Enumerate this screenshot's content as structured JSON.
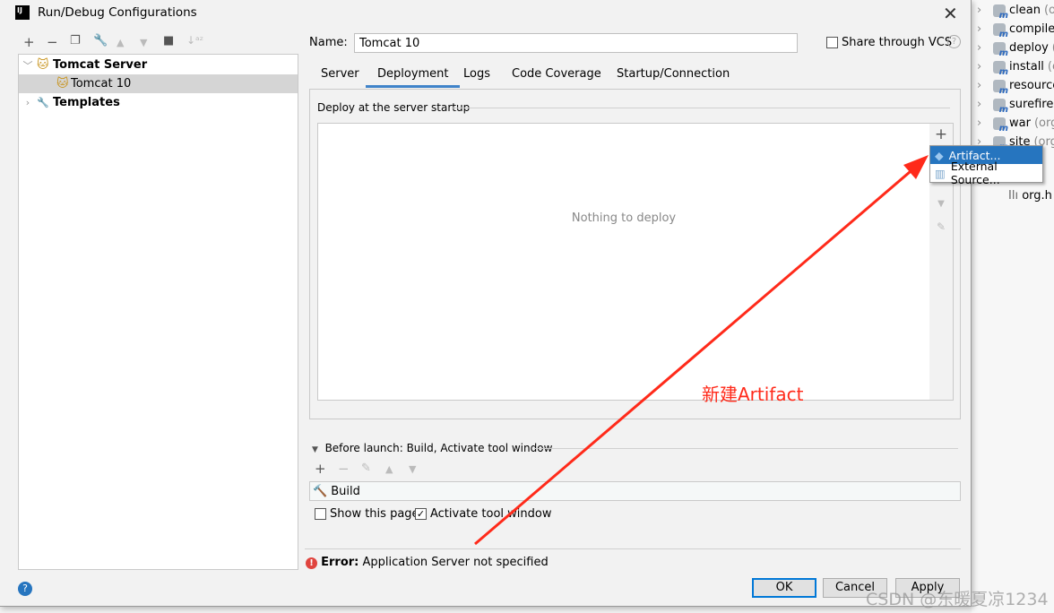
{
  "dialog": {
    "title": "Run/Debug Configurations",
    "logo": "IJ"
  },
  "toolbar": {
    "icons": [
      "plus-icon",
      "minus-icon",
      "copy-icon",
      "wrench-icon",
      "arrow-up-icon",
      "arrow-down-icon",
      "folder-add-icon",
      "sort-az-icon"
    ]
  },
  "tree": {
    "items": [
      {
        "label": "Tomcat Server",
        "expanded": true
      },
      {
        "label": "Tomcat 10",
        "selected": true
      },
      {
        "label": "Templates",
        "expanded": false
      }
    ]
  },
  "name": {
    "label": "Name:",
    "value": "Tomcat 10"
  },
  "share": {
    "label": "Share through VCS",
    "checked": false
  },
  "tabs": [
    "Server",
    "Deployment",
    "Logs",
    "Code Coverage",
    "Startup/Connection"
  ],
  "active_tab": "Deployment",
  "deploy": {
    "title": "Deploy at the server startup",
    "empty": "Nothing to deploy"
  },
  "popup": {
    "items": [
      "Artifact...",
      "External Source..."
    ]
  },
  "before_launch": {
    "title": "Before launch: Build, Activate tool window",
    "item": "Build"
  },
  "options": {
    "show_page": "Show this page",
    "show_page_checked": false,
    "activate": "Activate tool window",
    "activate_checked": true
  },
  "error": {
    "label": "Error:",
    "message": "Application Server not specified"
  },
  "buttons": {
    "ok": "OK",
    "cancel": "Cancel",
    "apply": "Apply"
  },
  "annotation": {
    "text": "新建Artifact",
    "color": "#ff2a1a"
  },
  "watermark": "CSDN @东暖夏凉1234",
  "maven": [
    {
      "name": "clean",
      "suffix": "(or"
    },
    {
      "name": "compiler",
      "suffix": ""
    },
    {
      "name": "deploy",
      "suffix": "(o"
    },
    {
      "name": "install",
      "suffix": "(or"
    },
    {
      "name": "resource",
      "suffix": ""
    },
    {
      "name": "surefire",
      "suffix": "("
    },
    {
      "name": "war",
      "suffix": "(org."
    },
    {
      "name": "site",
      "suffix": "(org."
    }
  ],
  "maven_extra": "org.h"
}
